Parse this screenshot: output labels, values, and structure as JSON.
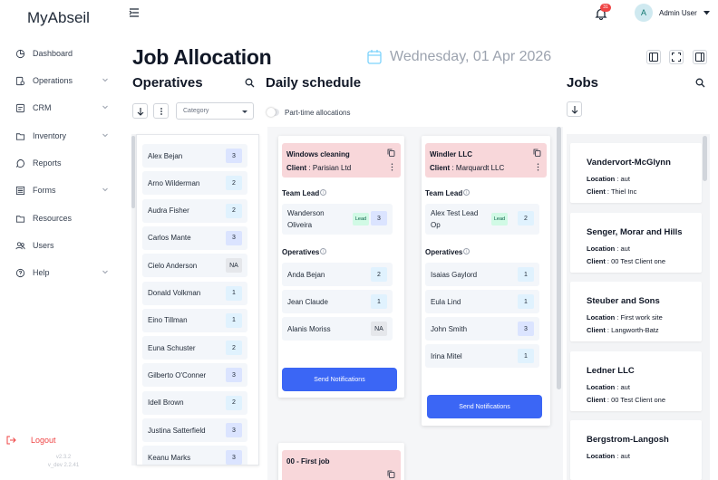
{
  "sidebar": {
    "brand": "MyAbseil",
    "items": [
      {
        "label": "Dashboard",
        "icon": "dashboard-icon",
        "chevron": false
      },
      {
        "label": "Operations",
        "icon": "operations-icon",
        "chevron": true
      },
      {
        "label": "CRM",
        "icon": "crm-icon",
        "chevron": true
      },
      {
        "label": "Inventory",
        "icon": "folder-icon",
        "chevron": true
      },
      {
        "label": "Reports",
        "icon": "chat-icon",
        "chevron": false
      },
      {
        "label": "Forms",
        "icon": "forms-icon",
        "chevron": true
      },
      {
        "label": "Resources",
        "icon": "folder-icon",
        "chevron": false
      },
      {
        "label": "Users",
        "icon": "users-icon",
        "chevron": false
      },
      {
        "label": "Help",
        "icon": "help-icon",
        "chevron": true
      }
    ],
    "logout": "Logout",
    "version": "v2.3.2",
    "env": "v_dev 2.2.41"
  },
  "topbar": {
    "notification_count": "31",
    "avatar_initial": "A",
    "user_name": "Admin User"
  },
  "page": {
    "title": "Job Allocation",
    "date": "Wednesday, 01 Apr 2026"
  },
  "operatives": {
    "title": "Operatives",
    "category_placeholder": "Category",
    "rows": [
      {
        "name": "Alex Bejan",
        "count": "3"
      },
      {
        "name": "Arno Wilderman",
        "count": "2"
      },
      {
        "name": "Audra Fisher",
        "count": "2"
      },
      {
        "name": "Carlos Mante",
        "count": "3"
      },
      {
        "name": "Cielo Anderson",
        "count": "NA"
      },
      {
        "name": "Donald Volkman",
        "count": "1"
      },
      {
        "name": "Eino Tillman",
        "count": "1"
      },
      {
        "name": "Euna Schuster",
        "count": "2"
      },
      {
        "name": "Gilberto O'Conner",
        "count": "3"
      },
      {
        "name": "Idell Brown",
        "count": "2"
      },
      {
        "name": "Justina Satterfield",
        "count": "3"
      },
      {
        "name": "Keanu Marks",
        "count": "3"
      }
    ]
  },
  "schedule": {
    "title": "Daily schedule",
    "parttime_label": "Part-time allocations",
    "team_lead_label": "Team Lead",
    "operatives_label": "Operatives",
    "client_label": "Client",
    "lead_label": "Lead",
    "send_label": "Send Notifications",
    "cards": [
      {
        "name": "Windows cleaning",
        "client": "Parisian Ltd",
        "lead_name_1": "Wanderson",
        "lead_name_2": "Oliveira",
        "lead_count": "3",
        "operatives": [
          {
            "name": "Anda Bejan",
            "count": "2"
          },
          {
            "name": "Jean Claude",
            "count": "1"
          },
          {
            "name": "Alanis Moriss",
            "count": "NA"
          }
        ]
      },
      {
        "name": "Windler LLC",
        "client": "Marquardt LLC",
        "lead_name_1": "Alex Test Lead",
        "lead_name_2": "Op",
        "lead_count": "2",
        "operatives": [
          {
            "name": "Isaias Gaylord",
            "count": "1"
          },
          {
            "name": "Eula Lind",
            "count": "1"
          },
          {
            "name": "John Smith",
            "count": "3"
          },
          {
            "name": "Irina Mitel",
            "count": "1"
          }
        ]
      },
      {
        "name": "00 - First job"
      }
    ]
  },
  "jobs": {
    "title": "Jobs",
    "location_label": "Location",
    "client_label": "Client",
    "items": [
      {
        "name": "Vandervort-McGlynn",
        "location": "aut",
        "client": "Thiel Inc"
      },
      {
        "name": "Senger, Morar and Hills",
        "location": "aut",
        "client": "00 Test Client one"
      },
      {
        "name": "Steuber and Sons",
        "location": "First work site",
        "client": "Langworth-Batz"
      },
      {
        "name": "Ledner LLC",
        "location": "aut",
        "client": "00 Test Client one"
      },
      {
        "name": "Bergstrom-Langosh",
        "location": "aut",
        "client": ""
      }
    ]
  },
  "colors": {
    "accent": "#3b66f5",
    "job_header": "#f8d7da",
    "badge_1": "#e0f2fe",
    "badge_2": "#e0f2fe",
    "badge_3": "#dbe4ff",
    "badge_na": "#e5e7eb",
    "danger": "#ef4444"
  }
}
